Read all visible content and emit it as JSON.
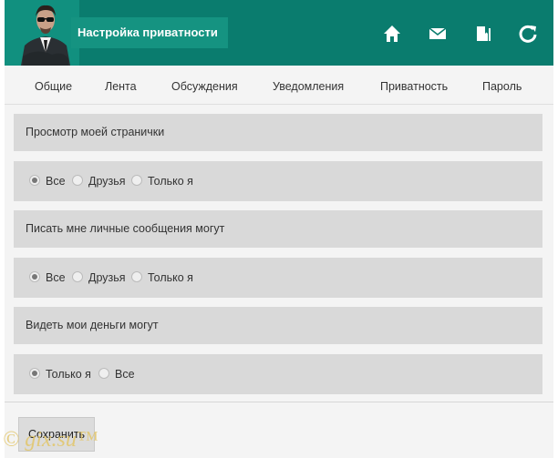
{
  "header": {
    "title": "Настройка приватности",
    "icons": [
      "home-icon",
      "mail-icon",
      "book-icon",
      "refresh-icon"
    ],
    "bg_color": "#0a7c6e"
  },
  "tabs": [
    {
      "label": "Общие"
    },
    {
      "label": "Лента"
    },
    {
      "label": "Обсуждения"
    },
    {
      "label": "Уведомления"
    },
    {
      "label": "Приватность"
    },
    {
      "label": "Пароль"
    }
  ],
  "settings": [
    {
      "label": "Просмотр моей странички",
      "options": [
        {
          "label": "Все",
          "checked": true
        },
        {
          "label": "Друзья",
          "checked": false
        },
        {
          "label": "Только я",
          "checked": false
        }
      ]
    },
    {
      "label": "Писать мне личные сообщения могут",
      "options": [
        {
          "label": "Все",
          "checked": true
        },
        {
          "label": "Друзья",
          "checked": false
        },
        {
          "label": "Только я",
          "checked": false
        }
      ]
    },
    {
      "label": "Видеть мои деньги могут",
      "options": [
        {
          "label": "Только я",
          "checked": true
        },
        {
          "label": "Все",
          "checked": false
        }
      ]
    }
  ],
  "save_label": "Сохранить",
  "watermark": "© gix.su™"
}
